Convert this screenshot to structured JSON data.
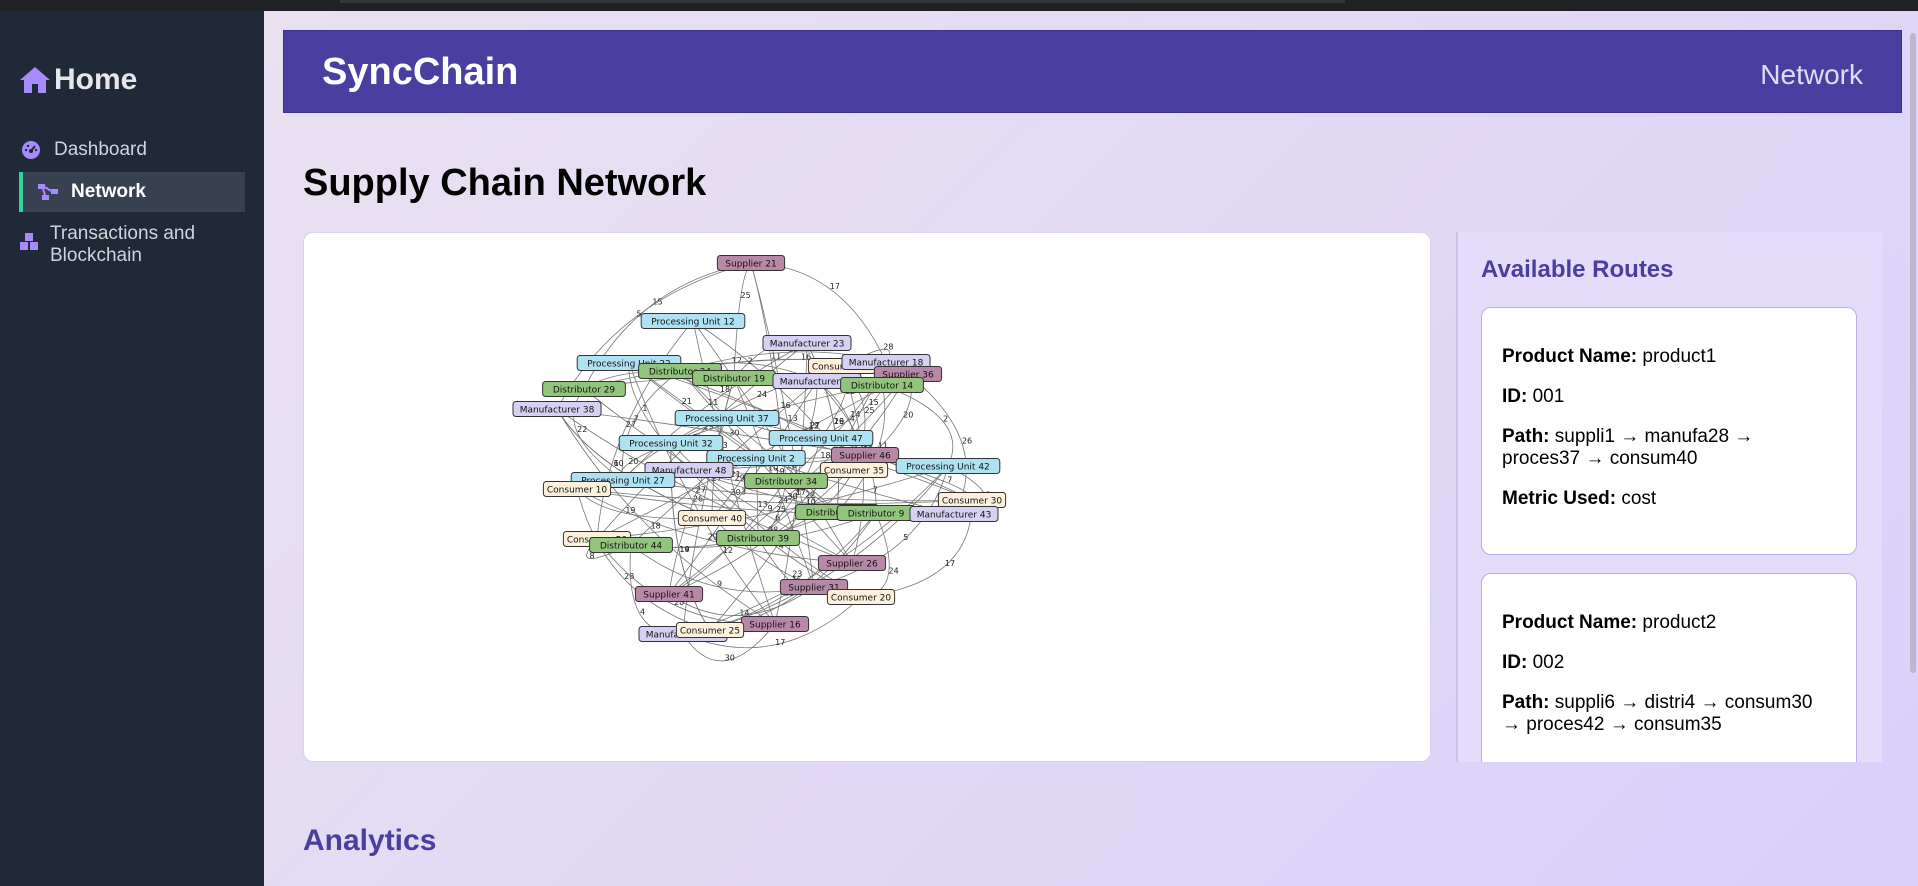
{
  "sidebar": {
    "home_label": "Home",
    "items": [
      {
        "label": "Dashboard",
        "icon": "gauge-icon"
      },
      {
        "label": "Network",
        "icon": "network-icon",
        "active": true
      },
      {
        "label": "Transactions and Blockchain",
        "icon": "cubes-icon"
      }
    ]
  },
  "header": {
    "brand": "SyncChain",
    "nav_link": "Network"
  },
  "page_title": "Supply Chain Network",
  "routes": {
    "title": "Available Routes",
    "labels": {
      "product_name": "Product Name:",
      "id": "ID:",
      "path": "Path:",
      "metric": "Metric Used:"
    },
    "items": [
      {
        "product_name": "product1",
        "id": "001",
        "path": "suppli1 → manufa28 → proces37 → consum40",
        "metric": "cost"
      },
      {
        "product_name": "product2",
        "id": "002",
        "path": "suppli6 → distri4 → consum30 → proces42 → consum35",
        "metric": ""
      }
    ]
  },
  "analytics_title": "Analytics",
  "network": {
    "colors": {
      "Supplier": "#b888a8",
      "Manufacturer": "#d6d0f5",
      "Processing Unit": "#aee2f3",
      "Distributor": "#93c47d",
      "Consumer": "#fdf1dc"
    },
    "nodes": [
      {
        "label": "Supplier 21",
        "type": "Supplier"
      },
      {
        "label": "Processing Unit 12",
        "type": "Processing Unit"
      },
      {
        "label": "Manufacturer 23",
        "type": "Manufacturer"
      },
      {
        "label": "Consumer 45",
        "type": "Consumer"
      },
      {
        "label": "Manufacturer 18",
        "type": "Manufacturer"
      },
      {
        "label": "Supplier 36",
        "type": "Supplier"
      },
      {
        "label": "Processing Unit 22",
        "type": "Processing Unit"
      },
      {
        "label": "Distributor 24",
        "type": "Distributor"
      },
      {
        "label": "Distributor 19",
        "type": "Distributor"
      },
      {
        "label": "Manufacturer 13",
        "type": "Manufacturer"
      },
      {
        "label": "Distributor 14",
        "type": "Distributor"
      },
      {
        "label": "Distributor 29",
        "type": "Distributor"
      },
      {
        "label": "Manufacturer 38",
        "type": "Manufacturer"
      },
      {
        "label": "Processing Unit 37",
        "type": "Processing Unit"
      },
      {
        "label": "Processing Unit 47",
        "type": "Processing Unit"
      },
      {
        "label": "Processing Unit 32",
        "type": "Processing Unit"
      },
      {
        "label": "Processing Unit 2",
        "type": "Processing Unit"
      },
      {
        "label": "Supplier 46",
        "type": "Supplier"
      },
      {
        "label": "Consumer 35",
        "type": "Consumer"
      },
      {
        "label": "Processing Unit 42",
        "type": "Processing Unit"
      },
      {
        "label": "Manufacturer 48",
        "type": "Manufacturer"
      },
      {
        "label": "Processing Unit 27",
        "type": "Processing Unit"
      },
      {
        "label": "Distributor 34",
        "type": "Distributor"
      },
      {
        "label": "Consumer 10",
        "type": "Consumer"
      },
      {
        "label": "Consumer 30",
        "type": "Consumer"
      },
      {
        "label": "Distributor 49",
        "type": "Distributor"
      },
      {
        "label": "Distributor 9",
        "type": "Distributor"
      },
      {
        "label": "Manufacturer 43",
        "type": "Manufacturer"
      },
      {
        "label": "Consumer 40",
        "type": "Consumer"
      },
      {
        "label": "Consumer 50",
        "type": "Consumer"
      },
      {
        "label": "Distributor 44",
        "type": "Distributor"
      },
      {
        "label": "Distributor 39",
        "type": "Distributor"
      },
      {
        "label": "Supplier 26",
        "type": "Supplier"
      },
      {
        "label": "Supplier 31",
        "type": "Supplier"
      },
      {
        "label": "Consumer 20",
        "type": "Consumer"
      },
      {
        "label": "Supplier 41",
        "type": "Supplier"
      },
      {
        "label": "Supplier 16",
        "type": "Supplier"
      },
      {
        "label": "Manufacturer 33",
        "type": "Manufacturer"
      },
      {
        "label": "Consumer 25",
        "type": "Consumer"
      }
    ],
    "edge_labels": [
      "15",
      "11",
      "13",
      "22",
      "27",
      "29",
      "6",
      "5",
      "9",
      "28",
      "24",
      "17",
      "12",
      "14",
      "16",
      "20",
      "21",
      "18",
      "30",
      "26",
      "7",
      "10",
      "19",
      "23",
      "25",
      "8",
      "3",
      "2",
      "4",
      "1"
    ]
  }
}
